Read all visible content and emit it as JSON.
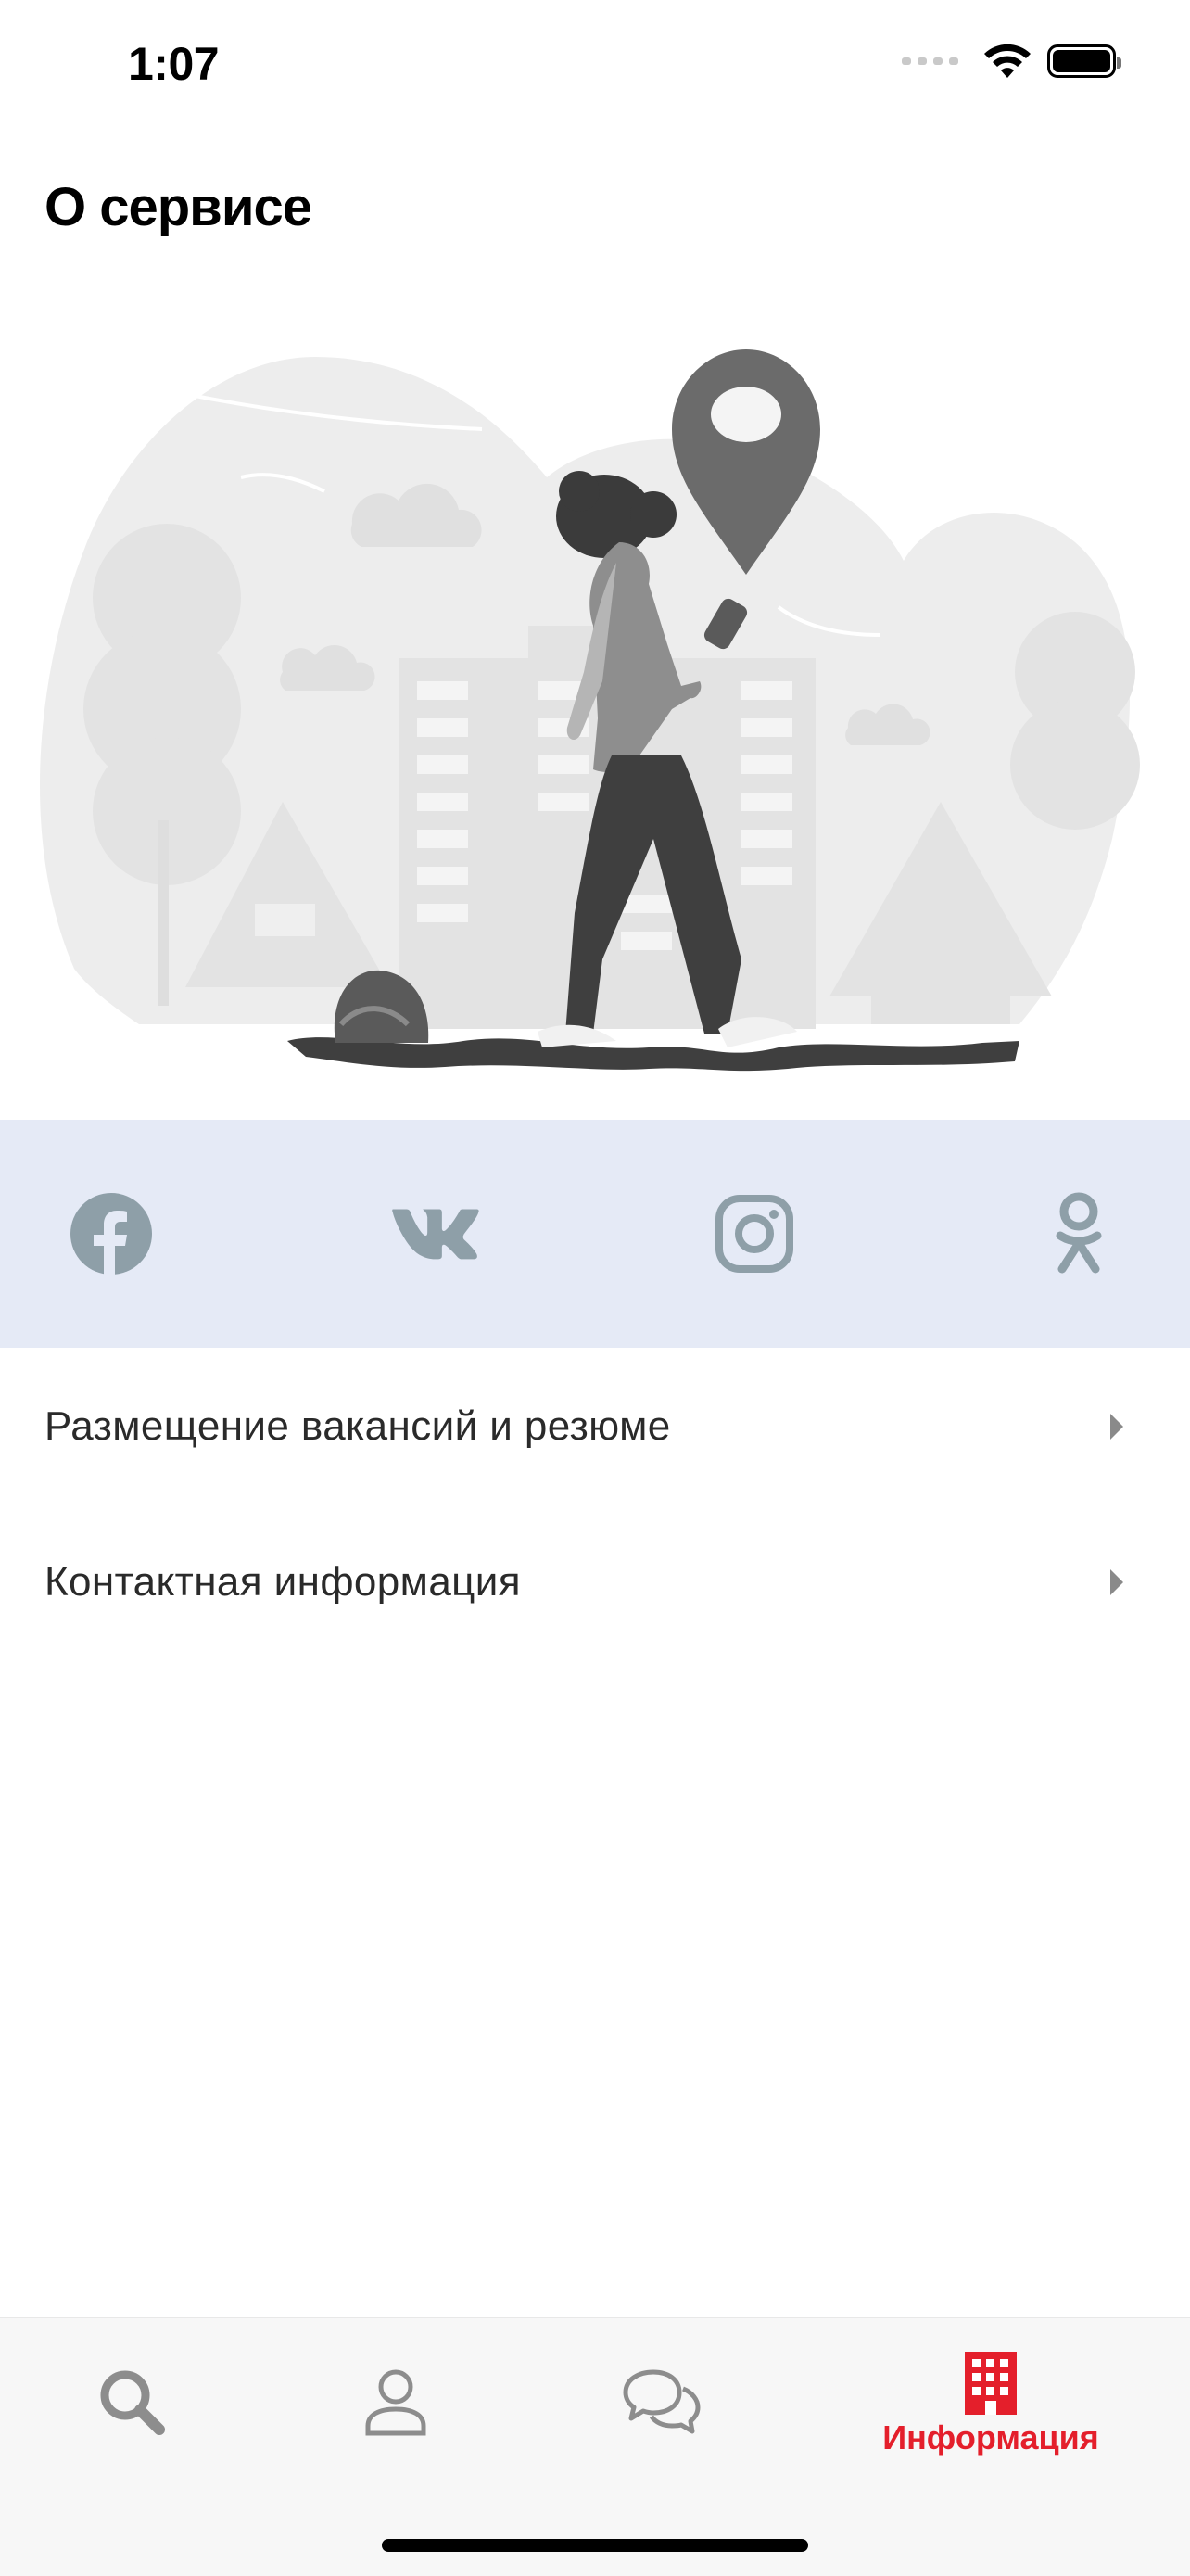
{
  "status": {
    "time": "1:07"
  },
  "header": {
    "title": "О сервисе"
  },
  "social": {
    "items": [
      {
        "icon": "facebook-icon"
      },
      {
        "icon": "vk-icon"
      },
      {
        "icon": "instagram-icon"
      },
      {
        "icon": "odnoklassniki-icon"
      }
    ],
    "icon_color": "#8e9fa8",
    "band_color": "#e5eaf6"
  },
  "menu": {
    "items": [
      {
        "label": "Размещение вакансий и резюме"
      },
      {
        "label": "Контактная информация"
      }
    ]
  },
  "tabbar": {
    "tabs": [
      {
        "icon": "search-icon",
        "label": ""
      },
      {
        "icon": "profile-icon",
        "label": ""
      },
      {
        "icon": "chat-icon",
        "label": ""
      },
      {
        "icon": "building-icon",
        "label": "Информация",
        "active": true
      }
    ],
    "active_color": "#e41f2b",
    "inactive_color": "#8d8d8d"
  }
}
